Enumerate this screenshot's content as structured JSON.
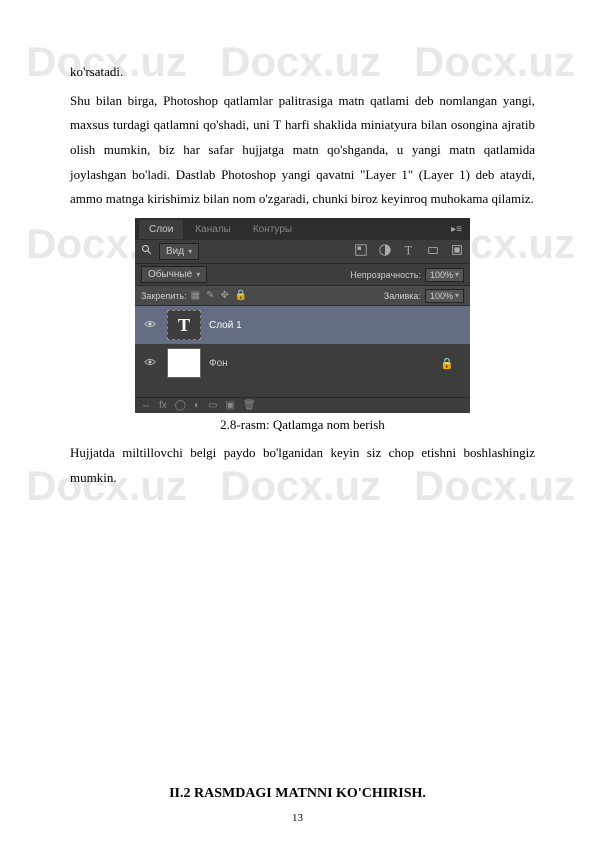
{
  "watermark": "Docx.uz",
  "body": {
    "p1_word1": "ko'rsatadi.",
    "p2": "Shu bilan birga, Photoshop qatlamlar palitrasiga matn qatlami deb nomlangan yangi, maxsus turdagi qatlamni qo'shadi, uni T harfi shaklida miniatyura bilan osongina ajratib olish mumkin, biz har safar hujjatga matn qo'shganda, u yangi matn qatlamida joylashgan bo'ladi. Dastlab Photoshop yangi qavatni \"Layer 1\" (Layer 1) deb ataydi, ammo matnga kirishimiz bilan nom o'zgaradi, chunki biroz keyinroq muhokama qilamiz.",
    "caption": "2.8-rasm: Qatlamga nom berish",
    "p3": "Hujjatda miltillovchi belgi paydo bo'lganidan keyin siz chop etishni boshlashingiz mumkin."
  },
  "panel": {
    "tabs": {
      "t1": "Слои",
      "t2": "Каналы",
      "t3": "Контуры"
    },
    "mode": "Вид",
    "opacity_label": "Непрозрачность:",
    "opacity_value": "100%",
    "lock_label": "Закрепить:",
    "fill_label": "Заливка:",
    "fill_value": "100%",
    "layer1": "Слой 1",
    "layer_bg": "Фон",
    "thumb_letter": "T"
  },
  "heading": "II.2  RASMDAGI MATNNI KO'CHIRISH.",
  "page_number": "13"
}
